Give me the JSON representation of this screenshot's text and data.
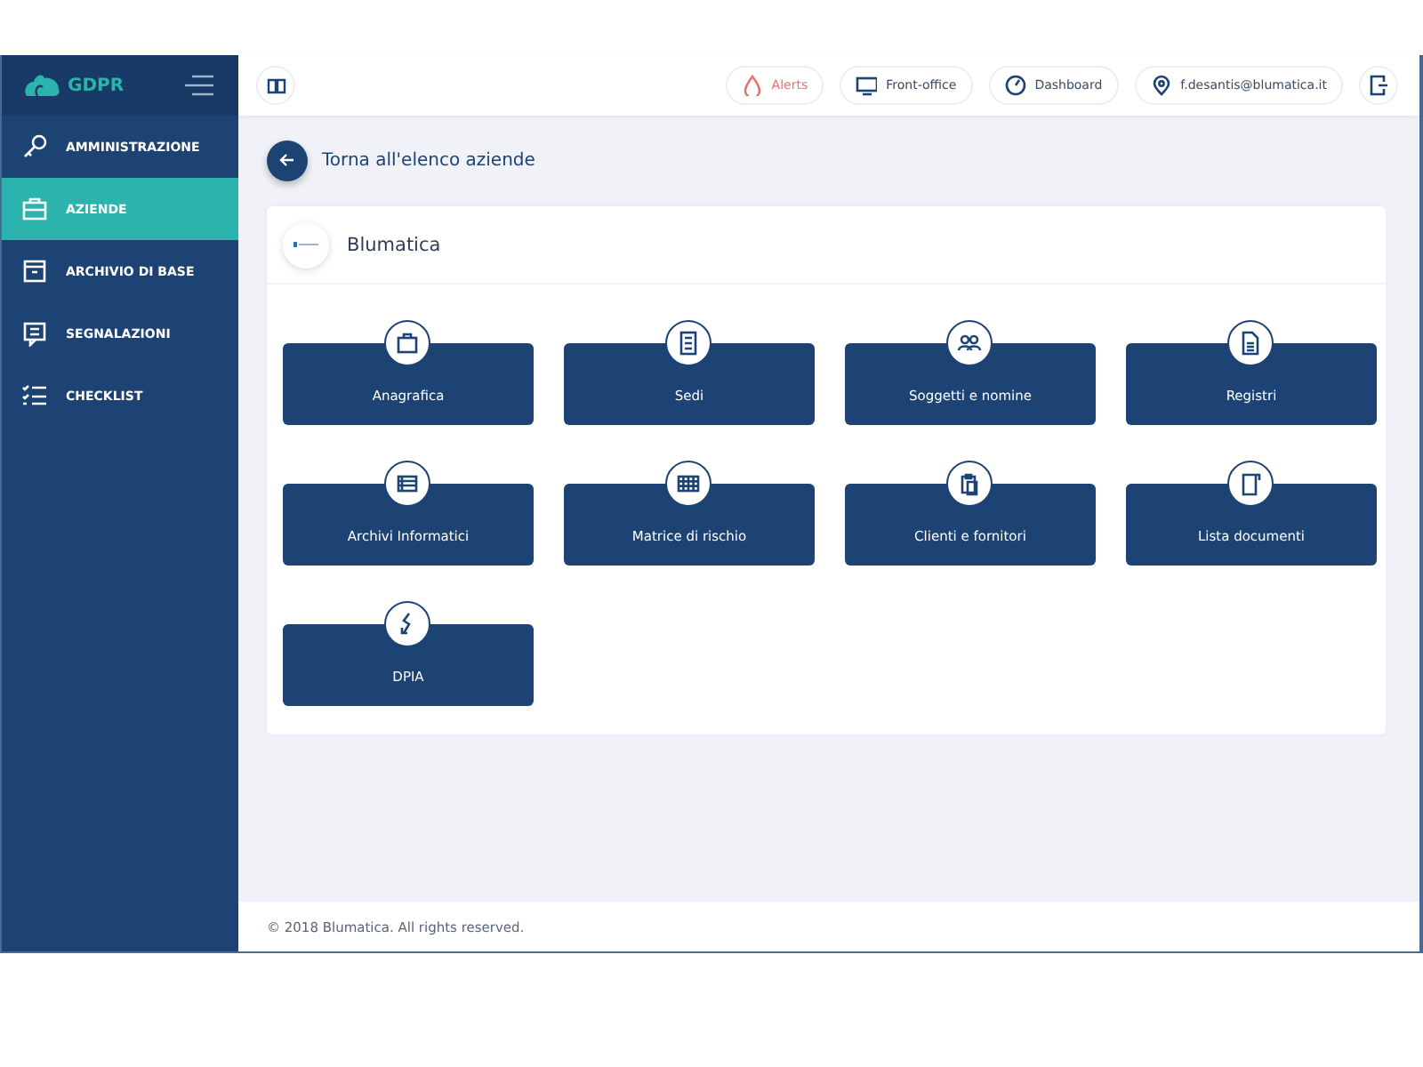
{
  "brand": {
    "title": "GDPR"
  },
  "sidebar": {
    "items": [
      {
        "label": "AMMINISTRAZIONE",
        "selected": false
      },
      {
        "label": "AZIENDE",
        "selected": true
      },
      {
        "label": "ARCHIVIO DI BASE",
        "selected": false
      },
      {
        "label": "SEGNALAZIONI",
        "selected": false
      },
      {
        "label": "CHECKLIST",
        "selected": false
      }
    ]
  },
  "topbar": {
    "items": [
      {
        "label": "Alerts",
        "kind": "alert"
      },
      {
        "label": "Front-office",
        "kind": "normal"
      },
      {
        "label": "Dashboard",
        "kind": "normal"
      },
      {
        "label": "f.desantis@blumatica.it",
        "kind": "normal"
      }
    ]
  },
  "back": {
    "label": "Torna all'elenco aziende"
  },
  "company": {
    "name": "Blumatica"
  },
  "tiles": [
    {
      "label": "Anagrafica"
    },
    {
      "label": "Sedi"
    },
    {
      "label": "Soggetti e nomine"
    },
    {
      "label": "Registri"
    },
    {
      "label": "Archivi Informatici"
    },
    {
      "label": "Matrice di rischio"
    },
    {
      "label": "Clienti e fornitori"
    },
    {
      "label": "Lista documenti"
    },
    {
      "label": "DPIA"
    }
  ],
  "footer": {
    "text": "© 2018 Blumatica. All rights reserved."
  }
}
